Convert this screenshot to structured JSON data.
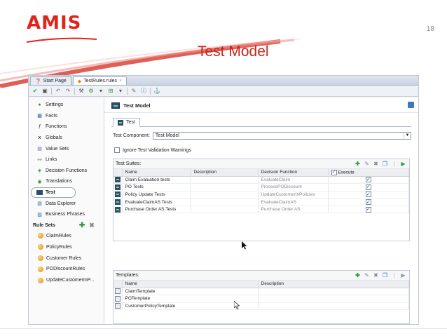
{
  "slide": {
    "logo": "AMIS",
    "number": "18",
    "title": "Test Model",
    "colors": {
      "brand_red": "#e2231a",
      "title_red": "#c8261b"
    }
  },
  "ide": {
    "tabs": [
      {
        "label": "Start Page",
        "icon": "help-icon"
      },
      {
        "label": "TestRules.rules",
        "icon": "rules-icon"
      }
    ],
    "sidebar": {
      "items": [
        {
          "label": "Settings",
          "icon": "settings-icon"
        },
        {
          "label": "Facts",
          "icon": "facts-icon"
        },
        {
          "label": "Functions",
          "icon": "function-icon"
        },
        {
          "label": "Globals",
          "icon": "globals-icon"
        },
        {
          "label": "Value Sets",
          "icon": "value-sets-icon"
        },
        {
          "label": "Links",
          "icon": "links-icon"
        },
        {
          "label": "Decision Functions",
          "icon": "decision-function-icon"
        },
        {
          "label": "Translations",
          "icon": "translations-icon"
        },
        {
          "label": "Test",
          "icon": "test-icon",
          "selected": true
        },
        {
          "label": "Data Explorer",
          "icon": "data-explorer-icon"
        },
        {
          "label": "Business Phrases",
          "icon": "business-phrases-icon"
        }
      ],
      "rule_sets_label": "Rule Sets",
      "rule_sets": [
        "ClaimRules",
        "PolicyRules",
        "Customer Rules",
        "PODiscountRules",
        "UpdateCustomerInP..."
      ]
    },
    "editor": {
      "title": "Test Model",
      "tab_label": "Test",
      "component_label": "Test Component:",
      "component_value": "Test Model",
      "ignore_warnings_label": "Ignore Test Validation Warnings",
      "suites": {
        "label": "Test Suites:",
        "columns": [
          "Name",
          "Description",
          "Decision Function",
          "Execute"
        ],
        "rows": [
          {
            "name": "Claim Evaluation tests",
            "description": "",
            "function": "EvaluateClaim",
            "execute": "✓"
          },
          {
            "name": "PO Tests",
            "description": "",
            "function": "ProcessPODiscount",
            "execute": "✓"
          },
          {
            "name": "Policy Update Tests",
            "description": "",
            "function": "UpdateCustomerInPolicies",
            "execute": "✓"
          },
          {
            "name": "EvaluateClaimAS Tests",
            "description": "",
            "function": "EvaluateClaimAS",
            "execute": "✓"
          },
          {
            "name": "Purchase Order AS Tests",
            "description": "",
            "function": "Purchase Order AS",
            "execute": "✓"
          }
        ]
      },
      "templates": {
        "label": "Templates:",
        "columns": [
          "Name",
          "Description"
        ],
        "rows": [
          {
            "name": "ClaimTemplate",
            "description": ""
          },
          {
            "name": "POTemplate",
            "description": ""
          },
          {
            "name": "CustomerPolicyTemplate",
            "description": ""
          }
        ]
      }
    }
  }
}
